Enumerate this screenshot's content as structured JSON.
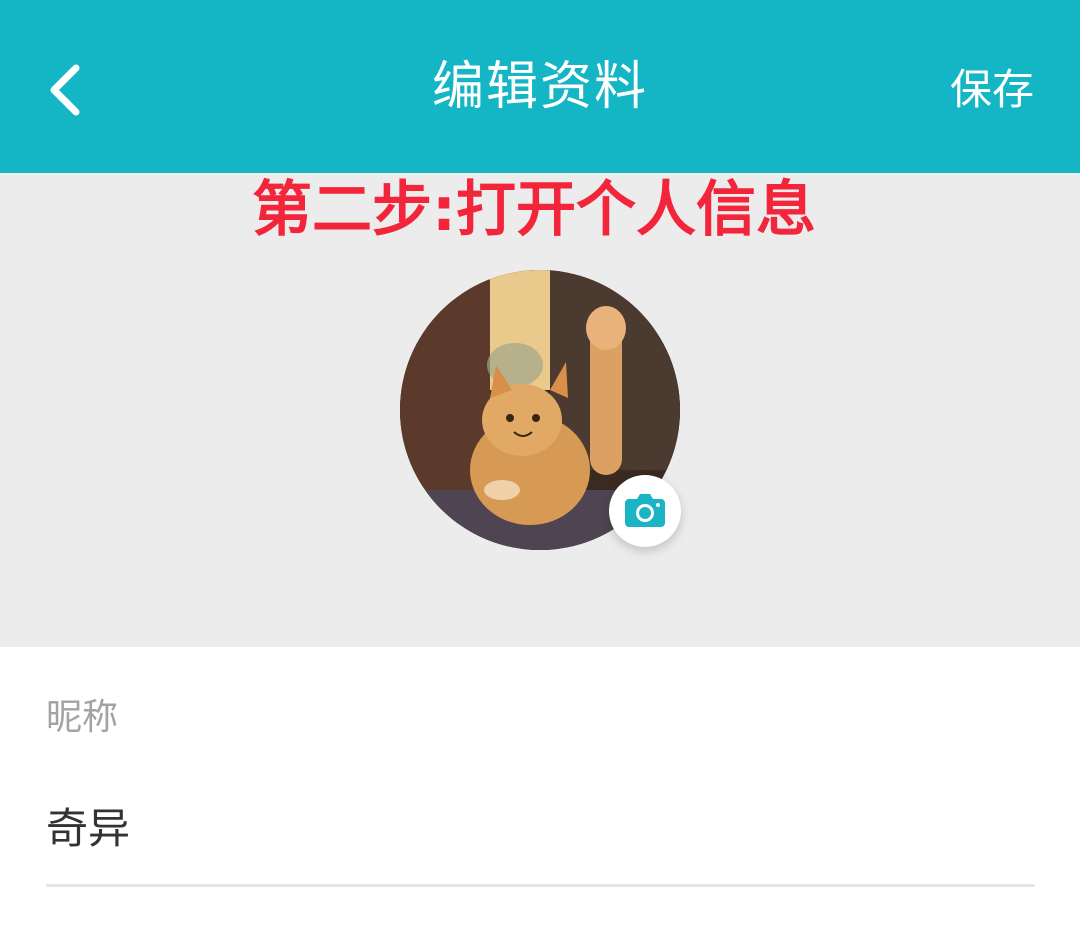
{
  "header": {
    "title": "编辑资料",
    "save_label": "保存",
    "background_color": "#14b6c6",
    "back_icon": "chevron-left-icon"
  },
  "annotation": {
    "text": "第二步:打开个人信息",
    "color": "#f3253a"
  },
  "avatar": {
    "image": "orange-cat-waving-photo",
    "camera_icon": "camera-icon"
  },
  "nickname": {
    "label": "昵称",
    "value": "奇异"
  }
}
